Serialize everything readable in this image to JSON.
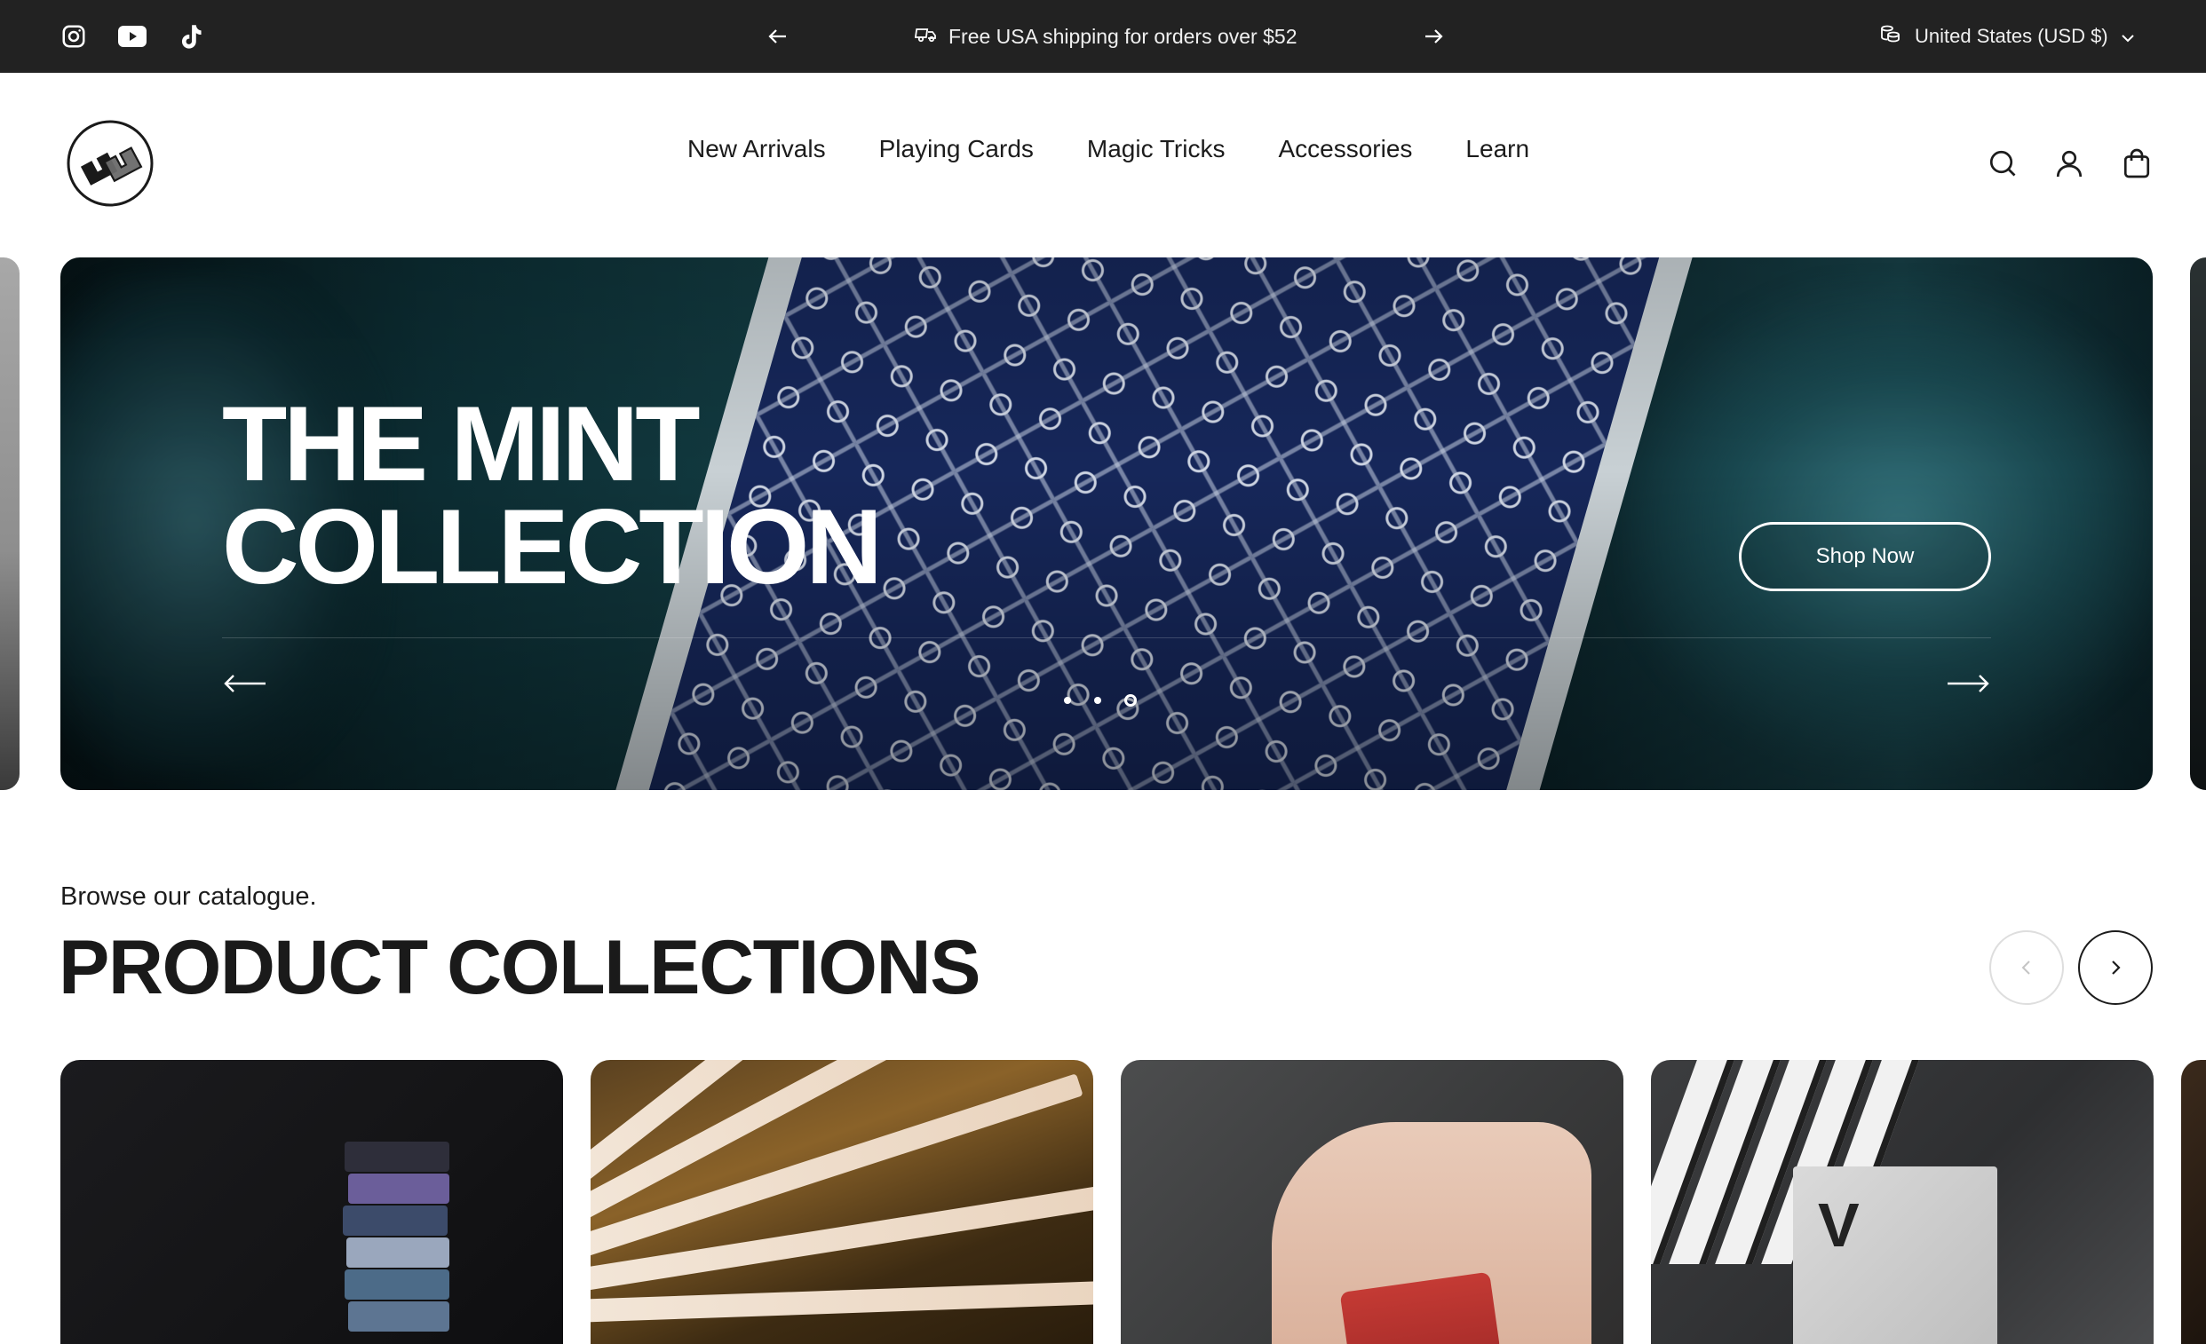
{
  "topbar": {
    "announcement": "Free USA shipping for orders over $52",
    "currency": "United States (USD $)",
    "social": [
      "instagram-icon",
      "youtube-icon",
      "tiktok-icon"
    ]
  },
  "nav": {
    "items": [
      "New Arrivals",
      "Playing Cards",
      "Magic Tricks",
      "Accessories",
      "Learn"
    ]
  },
  "hero": {
    "title_line1": "THE MINT",
    "title_line2": "COLLECTION",
    "button": "Shop Now",
    "slide_count": 3,
    "active_slide": 3
  },
  "collections": {
    "eyebrow": "Browse our catalogue.",
    "title": "PRODUCT COLLECTIONS"
  },
  "colors": {
    "topbar_bg": "#222222",
    "text": "#1c1c1c",
    "page_bg": "#ffffff"
  }
}
